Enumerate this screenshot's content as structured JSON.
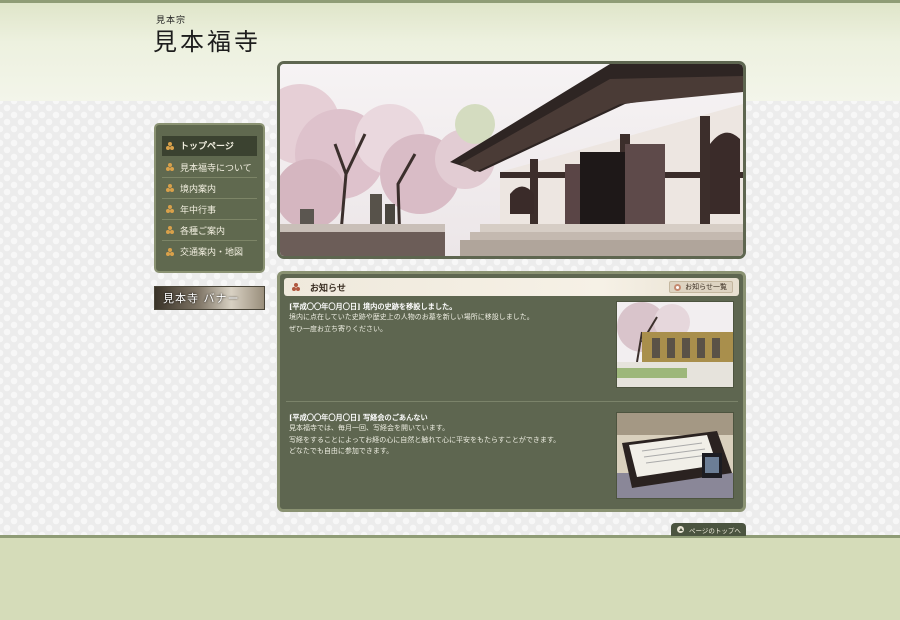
{
  "header": {
    "subtitle": "見本宗",
    "title": "見本福寺"
  },
  "nav": {
    "items": [
      {
        "label": "トップページ",
        "active": true
      },
      {
        "label": "見本福寺について",
        "active": false
      },
      {
        "label": "境内案内",
        "active": false
      },
      {
        "label": "年中行事",
        "active": false
      },
      {
        "label": "各種ご案内",
        "active": false
      },
      {
        "label": "交通案内・地図",
        "active": false
      }
    ]
  },
  "banner": {
    "label": "見本寺 バナー"
  },
  "news": {
    "title": "お知らせ",
    "list_button": "お知らせ一覧",
    "items": [
      {
        "title": "[平成〇〇年〇月〇日] 境内の史跡を移設しました。",
        "lines": [
          "境内に点在していた史跡や歴史上の人物のお墓を新しい場所に移設しました。",
          "ぜひ一度お立ち寄りください。"
        ]
      },
      {
        "title": "[平成〇〇年〇月〇日] 写経会のごあんない",
        "lines": [
          "見本福寺では、毎月一回、写経会を開いています。",
          "写経をすることによってお経の心に自然と触れて心に平安をもたらすことができます。",
          "どなたでも自由に参加できます。"
        ]
      }
    ]
  },
  "pagetop": {
    "label": "ページのトップへ"
  },
  "colors": {
    "panel": "#5e6650",
    "footer": "#d5dcb9",
    "accent": "#d9a14a"
  }
}
